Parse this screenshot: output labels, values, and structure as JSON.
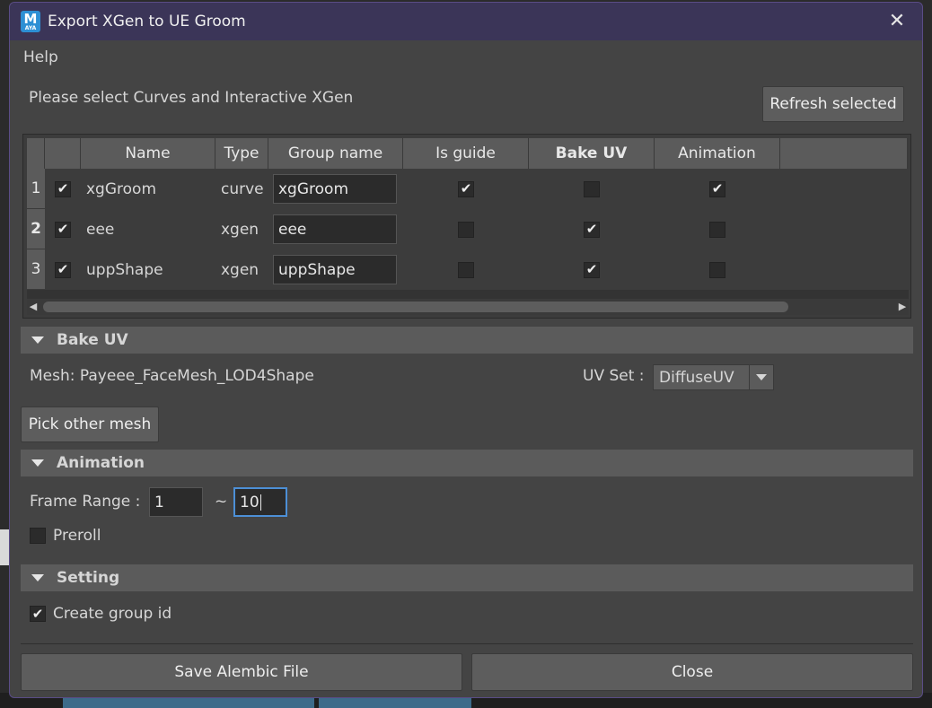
{
  "window": {
    "title": "Export XGen to UE Groom",
    "logo_letter": "M",
    "logo_sub": "AYA"
  },
  "menu": {
    "help": "Help"
  },
  "selection": {
    "prompt": "Please select Curves and Interactive XGen",
    "refresh_label": "Refresh selected"
  },
  "table": {
    "headers": {
      "name": "Name",
      "type": "Type",
      "group": "Group name",
      "guide": "Is guide",
      "bakeuv": "Bake UV",
      "anim": "Animation"
    },
    "rows": [
      {
        "num": "1",
        "selected": true,
        "name": "xgGroom",
        "type": "curve",
        "group": "xgGroom",
        "guide": true,
        "bakeuv": false,
        "anim": true
      },
      {
        "num": "2",
        "selected": true,
        "name": "eee",
        "type": "xgen",
        "group": "eee",
        "guide": false,
        "bakeuv": true,
        "anim": false
      },
      {
        "num": "3",
        "selected": true,
        "name": "uppShape",
        "type": "xgen",
        "group": "uppShape",
        "guide": false,
        "bakeuv": true,
        "anim": false
      }
    ]
  },
  "bake_uv": {
    "title": "Bake UV",
    "mesh_label": "Mesh: Payeee_FaceMesh_LOD4Shape",
    "uvset_label": "UV Set :",
    "uvset_value": "DiffuseUV",
    "pick_label": "Pick other mesh"
  },
  "animation": {
    "title": "Animation",
    "frame_range_label": "Frame Range :",
    "start": "1",
    "tilde": "~",
    "end": "10",
    "preroll_label": "Preroll",
    "preroll_checked": false
  },
  "setting": {
    "title": "Setting",
    "group_id_label": "Create group id",
    "group_id_checked": true
  },
  "buttons": {
    "save": "Save Alembic File",
    "close": "Close"
  },
  "check_glyph": "✔"
}
